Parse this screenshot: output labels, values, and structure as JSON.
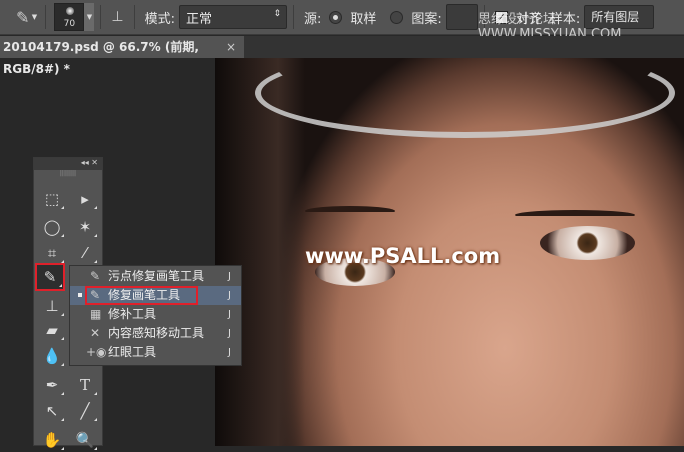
{
  "options_bar": {
    "brush_size": "70",
    "mode_label": "模式:",
    "mode_value": "正常",
    "source_label": "源:",
    "source_sampled": "取样",
    "source_pattern": "图案:",
    "align_label": "对齐",
    "sample_label": "样本:",
    "sample_value": "所有图层",
    "watermark": "思缘设计论坛 WWW.MISSYUAN.COM"
  },
  "document_tab": {
    "title": "20104179.psd @ 66.7% (前期, RGB/8#) *",
    "close": "×"
  },
  "canvas": {
    "watermark": "www.PSALL.com"
  },
  "toolbox": {
    "collapse": "◂◂",
    "close": "✕",
    "grip": "||||||||"
  },
  "flyout": {
    "items": [
      {
        "label": "污点修复画笔工具",
        "shortcut": "J",
        "selected": false
      },
      {
        "label": "修复画笔工具",
        "shortcut": "J",
        "selected": true
      },
      {
        "label": "修补工具",
        "shortcut": "J",
        "selected": false
      },
      {
        "label": "内容感知移动工具",
        "shortcut": "J",
        "selected": false
      },
      {
        "label": "红眼工具",
        "shortcut": "J",
        "selected": false
      }
    ]
  },
  "colors": {
    "highlight": "#e0202a",
    "panel": "#535353"
  }
}
